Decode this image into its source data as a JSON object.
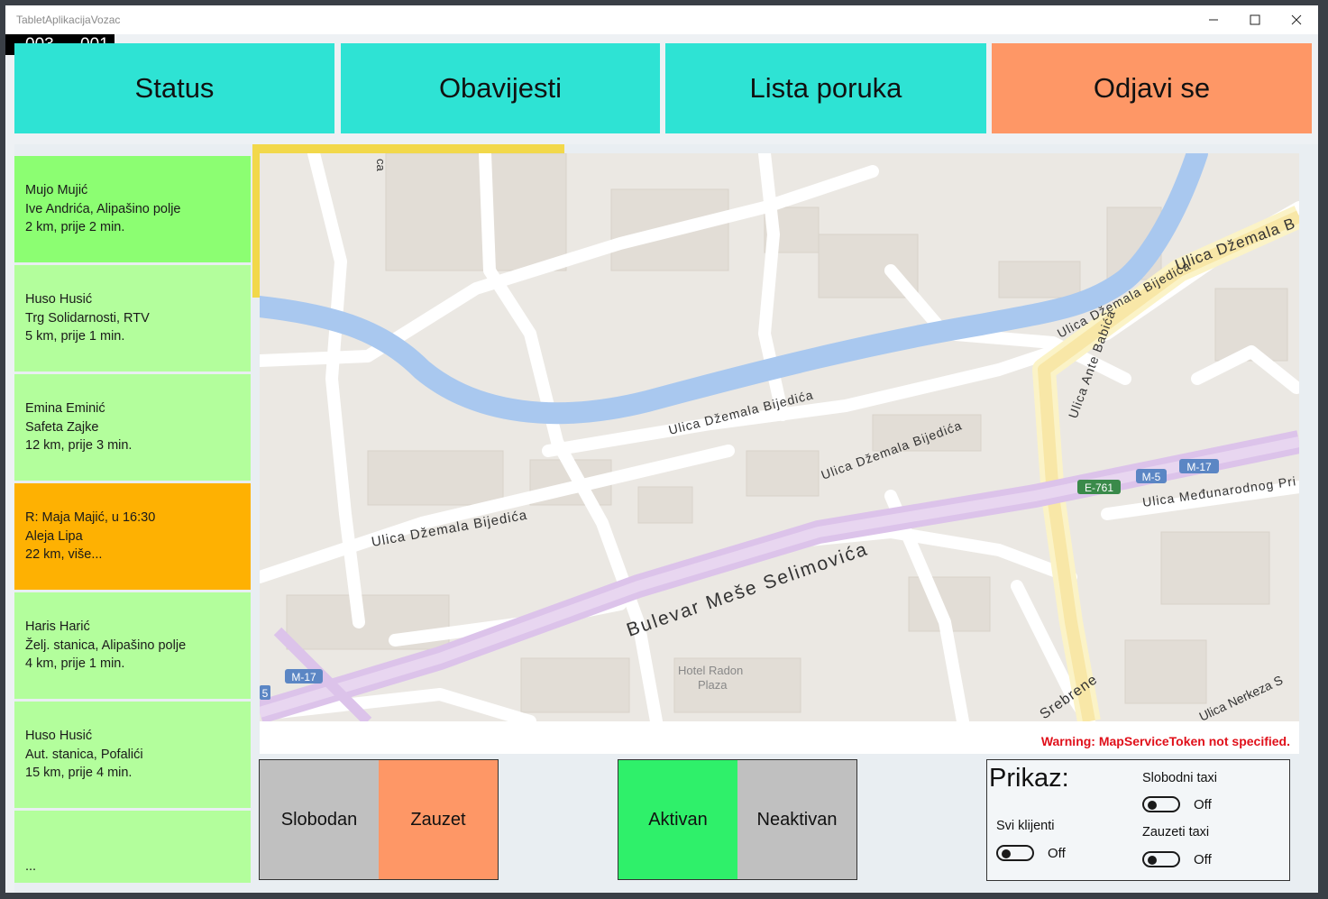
{
  "window": {
    "title": "TabletAplikacijaVozac"
  },
  "counters": {
    "left": "003",
    "right": "001"
  },
  "top_buttons": [
    {
      "label": "Status",
      "color": "#2ee3d4"
    },
    {
      "label": "Obavijesti",
      "color": "#2ee3d4"
    },
    {
      "label": "Lista poruka",
      "color": "#2ee3d4"
    },
    {
      "label": "Odjavi se",
      "color": "#fe9766"
    }
  ],
  "clients": [
    {
      "name": "Mujo Mujić",
      "address": "Ive Andrića, Alipašino polje",
      "info": "2 km, prije 2 min.",
      "color": "#8cfe72"
    },
    {
      "name": "Huso Husić",
      "address": "Trg Solidarnosti, RTV",
      "info": "5 km, prije 1 min.",
      "color": "#b3fe9c"
    },
    {
      "name": "Emina Eminić",
      "address": "Safeta Zajke",
      "info": "12 km, prije 3 min.",
      "color": "#b3fe9c"
    },
    {
      "name": "R: Maja Majić, u 16:30",
      "address": "Aleja Lipa",
      "info": "22 km, više...",
      "color": "#feb102"
    },
    {
      "name": "Haris Harić",
      "address": "Želj. stanica, Alipašino polje",
      "info": "4 km, prije 1 min.",
      "color": "#b3fe9c"
    },
    {
      "name": "Huso Husić",
      "address": "Aut. stanica, Pofalići",
      "info": "15 km, prije 4 min.",
      "color": "#b3fe9c"
    }
  ],
  "clients_more": "...",
  "map": {
    "labels": {
      "street_dz1": "Ulica Džemala Bijedića",
      "street_dz2": "Ulica Džemala Bijedića",
      "street_dz3": "Ulica Džemala Bijedića",
      "street_dz4": "Ulica Džemala Bijedića",
      "street_dz5": "Ulica Džemala B",
      "street_ante": "Ulica Ante Babića",
      "street_medj": "Ulica Međunarodnog Pri",
      "boulevard": "Bulevar Meše Selimovića",
      "hotel": "Hotel Radon",
      "hotel2": "Plaza",
      "srebrene": "Srebrene",
      "nerkeza": "Ulica Nerkeza S",
      "shield_e761": "E-761",
      "shield_m5": "M-5",
      "shield_m17": "M-17",
      "shield_m17b": "M-17",
      "shield_5": "5",
      "top_fragment": "ca"
    },
    "warning": "Warning: MapServiceToken not specified."
  },
  "status_toggle": {
    "free": "Slobodan",
    "busy": "Zauzet",
    "free_color": "#c0c0c0",
    "busy_color": "#fe9766"
  },
  "activity_toggle": {
    "active": "Aktivan",
    "inactive": "Neaktivan",
    "active_color": "#2ff06a",
    "inactive_color": "#c0c0c0"
  },
  "display": {
    "title": "Prikaz:",
    "all_clients": {
      "label": "Svi klijenti",
      "state": "Off"
    },
    "free_taxi": {
      "label": "Slobodni taxi",
      "state": "Off"
    },
    "busy_taxi": {
      "label": "Zauzeti taxi",
      "state": "Off"
    }
  }
}
